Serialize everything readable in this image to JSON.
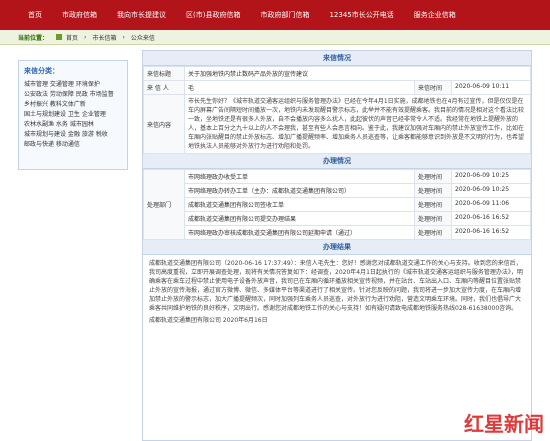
{
  "nav": {
    "items": [
      "首页",
      "市政府信箱",
      "我向市长提建议",
      "区(市)县政府信箱",
      "市政府部门信箱",
      "12345市长公开电话",
      "服务企业信箱"
    ]
  },
  "breadcrumb": {
    "label": "当前位置：",
    "items": [
      "首页",
      "市长信箱",
      "公众来信"
    ]
  },
  "sidebar": {
    "title": "来信分类：",
    "categories": [
      "城市管理 交通管理 环境保护",
      "公安政法 劳动保障 民政 市场监督",
      "乡村振兴 教科文体广新",
      "国土与规划建设 卫生 企业管理",
      "农林水副渔 水务 城市园林",
      "城市规划与建设 金融 旅游 税收",
      "邮政与快递 移动通信"
    ]
  },
  "letter": {
    "section_title": "来信情况",
    "subject_label": "来信标题",
    "subject": "关于加强地铁内禁止数码产品外放的宣传建议",
    "author_label": "来 信 人",
    "author": "毛",
    "time_label": "来信时间",
    "time": "2020-06-09 10:11",
    "content_label": "来信内容",
    "content": "市长先生你好？《城市轨道交通客运组织与服务管理办法》已经在今年4月1日实施，成都地铁也在4月有过宣传，但是仅仅是在车内屏幕广告间隔短时间播放一次，地铁内未发现醒目警示标志，此举并不能有效提醒乘客。我目前的情况是相对这个看法比较一致，坐地铁还是有很多人外放，自不会播放内容多么扰人，此起彼伏的声音已经非常令人不适。我经常在地铁上提醒外放的人，基本上百分之九十以上的人不会理我，甚至有些人会恶言相向。鉴于此，我建议加强对车厢内的禁止外放宣传工作，比如在车厢内张贴醒目的禁止外放标志、增加广播提醒频率、增加乘务人员巡查等，让乘客都能够意识到外放是不文明的行为，也希望地铁执法人员能够对外放行为进行劝阻和处罚。"
  },
  "handling": {
    "section_title": "办理情况",
    "label": "处理部门",
    "time_label": "处理时间",
    "rows": [
      {
        "text": "市网络理政办收受工单",
        "time": "2020-06-09 10:25"
      },
      {
        "text": "市网络理政办转办工单（主办：成都轨道交通集团有限公司）",
        "time": "2020-06-09 10:25"
      },
      {
        "text": "成都轨道交通集团有限公司签收工单",
        "time": "2020-06-09 11:06"
      },
      {
        "text": "成都轨道交通集团有限公司提交办理结果",
        "time": "2020-06-16 16:52"
      },
      {
        "text": "市网络理政办审核成都轨道交通集团有限公司延期申请（通过）",
        "time": "2020-06-16 16:52"
      }
    ]
  },
  "result": {
    "section_title": "办理结果",
    "text": "成都轨道交通集团有限公司（2020-06-16 17:37:49）：来信人毛先生：您好！感谢您对成都轨道交通工作的关心与支持。收到您的来信后，我司高度重视，立即开展调查处理，现将有关情况答复如下：经调查，2020年4月1日起执行的《城市轨道交通客运组织与服务管理办法》，明确乘客在乘车过程中禁止使用电子设备外放声音，我司已在车厢内循环播放相关宣传视频，并在站台、车站出入口、车厢内等醒目位置张贴禁止外放的宣传海报，通过官方微博、微信、多媒体平台等渠道进行了相关宣传。针对您反映的问题，我司将进一步加大宣传力度，在车厢内增加禁止外放的警示标志，加大广播提醒频次，同时加强列车乘务人员巡查，对外放行为进行劝阻，营造文明乘车环境。同时，我们也倡导广大乘客共同维护地铁的良好秩序，文明出行。感谢您对成都地铁工作的关心与支持！如有疑问请致电成都地铁服务热线028-61638000咨询。",
    "sign": "成都轨道交通集团有限公司  2020年6月16日"
  },
  "watermark": "红星新闻",
  "colors": {
    "topbar": "#b3141a",
    "accent": "#2f66b0",
    "crumb_bg": "#eef3df"
  }
}
